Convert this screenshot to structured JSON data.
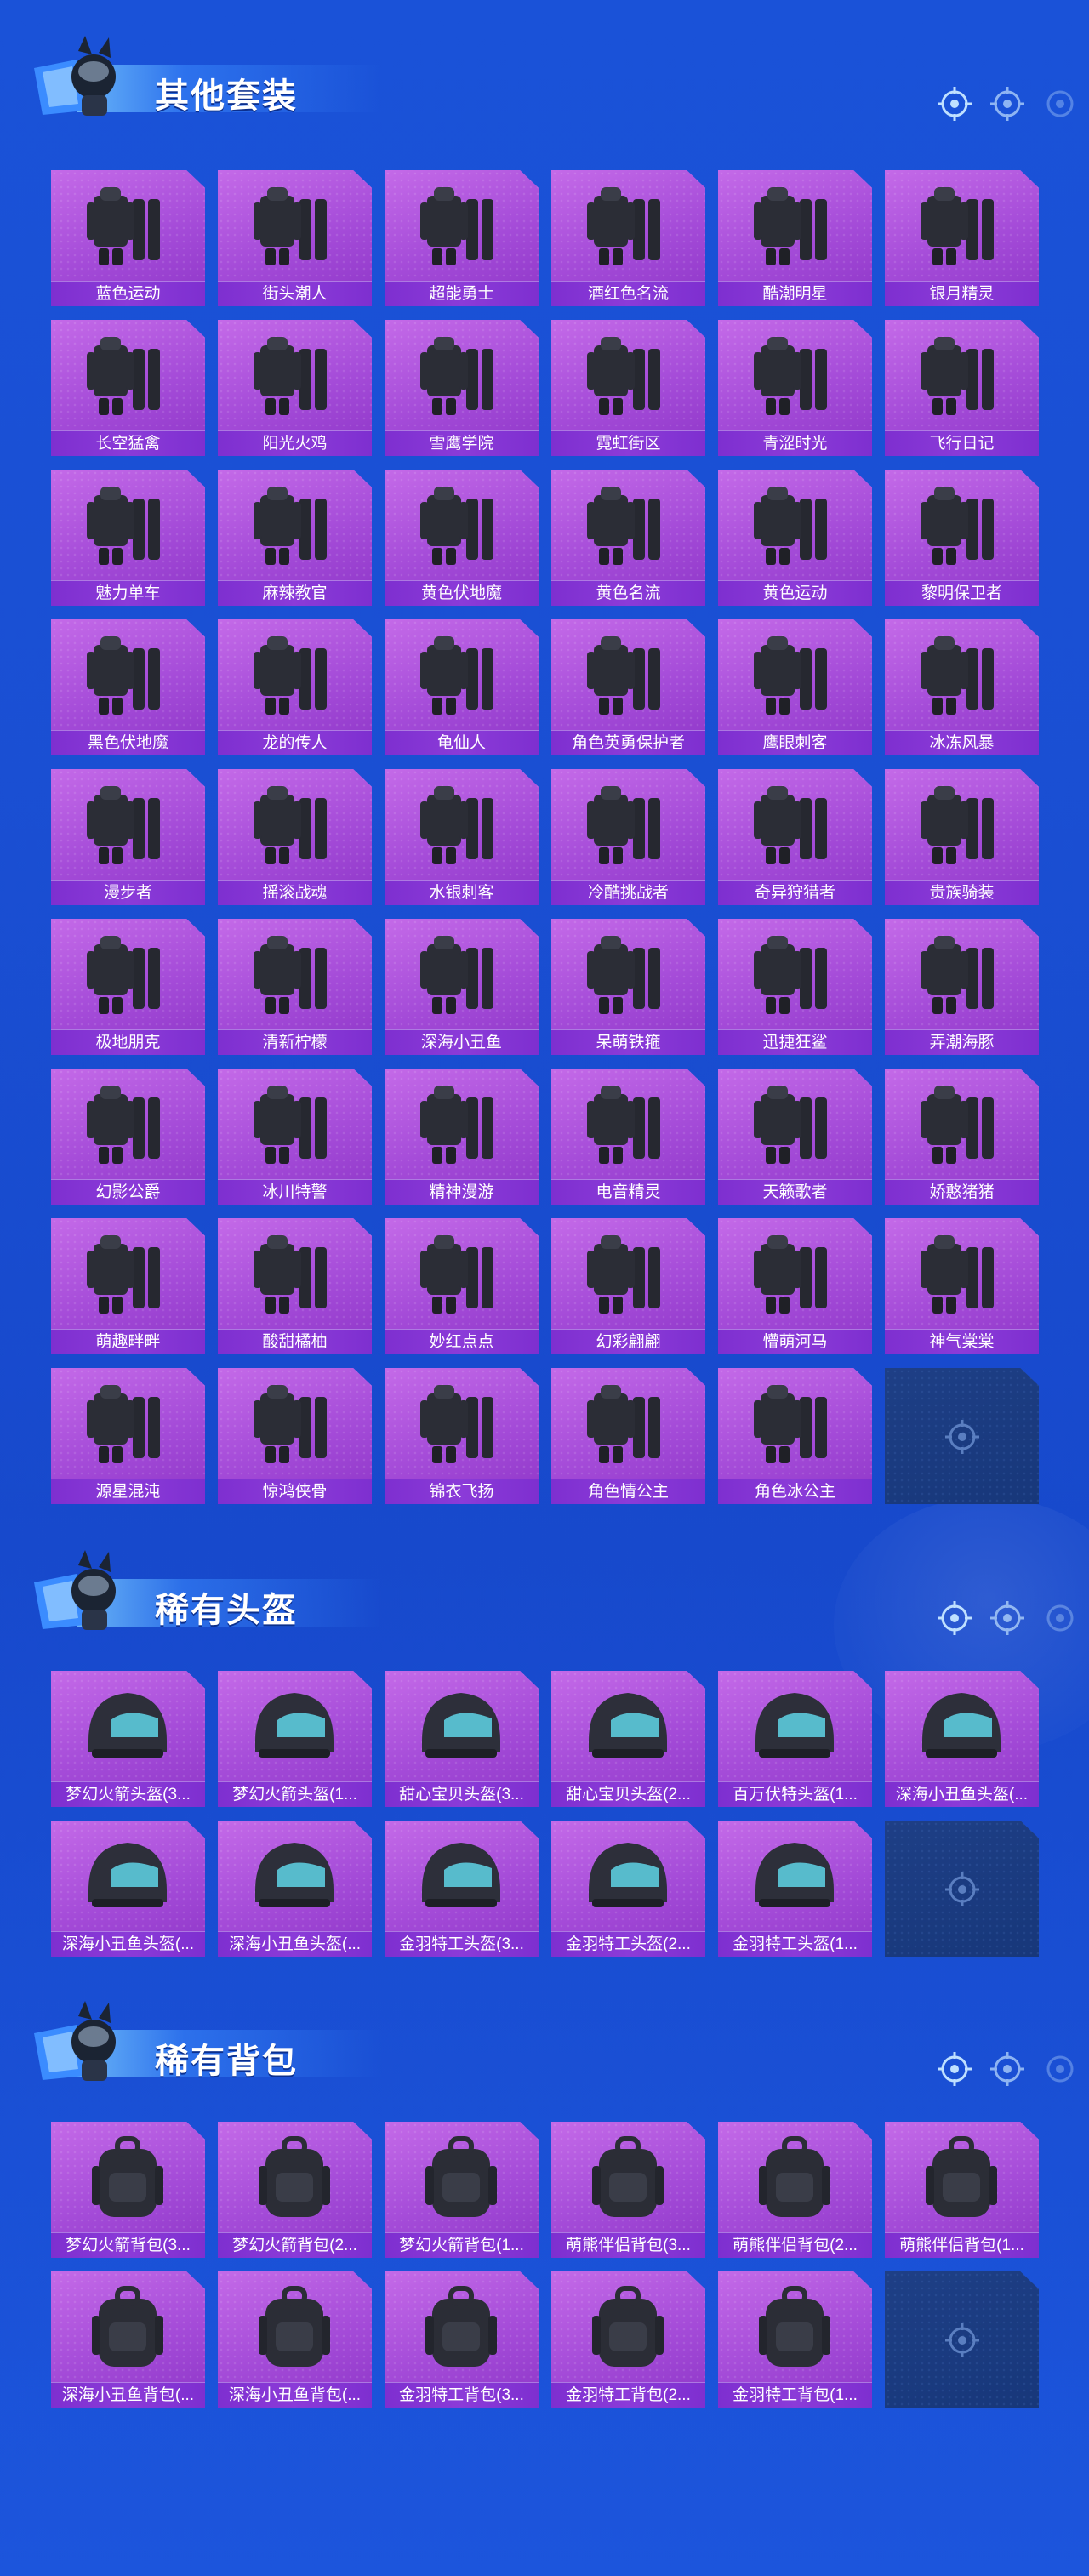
{
  "colors": {
    "background": "#1a52d8",
    "card": "#a44bd8",
    "label_bar": "#7e2fd0",
    "empty_card": "#1e3f86"
  },
  "sections": [
    {
      "title": "其他套装",
      "items": [
        {
          "label": "蓝色运动",
          "icon": "outfit-icon"
        },
        {
          "label": "街头潮人",
          "icon": "outfit-icon"
        },
        {
          "label": "超能勇士",
          "icon": "outfit-icon"
        },
        {
          "label": "酒红色名流",
          "icon": "outfit-icon"
        },
        {
          "label": "酷潮明星",
          "icon": "outfit-icon"
        },
        {
          "label": "银月精灵",
          "icon": "outfit-icon"
        },
        {
          "label": "长空猛禽",
          "icon": "outfit-icon"
        },
        {
          "label": "阳光火鸡",
          "icon": "outfit-icon"
        },
        {
          "label": "雪鹰学院",
          "icon": "outfit-icon"
        },
        {
          "label": "霓虹街区",
          "icon": "outfit-icon"
        },
        {
          "label": "青涩时光",
          "icon": "outfit-icon"
        },
        {
          "label": "飞行日记",
          "icon": "outfit-icon"
        },
        {
          "label": "魅力单车",
          "icon": "outfit-icon"
        },
        {
          "label": "麻辣教官",
          "icon": "outfit-icon"
        },
        {
          "label": "黄色伏地魔",
          "icon": "outfit-icon"
        },
        {
          "label": "黄色名流",
          "icon": "outfit-icon"
        },
        {
          "label": "黄色运动",
          "icon": "outfit-icon"
        },
        {
          "label": "黎明保卫者",
          "icon": "outfit-icon"
        },
        {
          "label": "黑色伏地魔",
          "icon": "outfit-icon"
        },
        {
          "label": "龙的传人",
          "icon": "outfit-icon"
        },
        {
          "label": "龟仙人",
          "icon": "outfit-icon"
        },
        {
          "label": "角色英勇保护者",
          "icon": "outfit-icon"
        },
        {
          "label": "鹰眼刺客",
          "icon": "outfit-icon"
        },
        {
          "label": "冰冻风暴",
          "icon": "outfit-icon"
        },
        {
          "label": "漫步者",
          "icon": "outfit-icon"
        },
        {
          "label": "摇滚战魂",
          "icon": "outfit-icon"
        },
        {
          "label": "水银刺客",
          "icon": "outfit-icon"
        },
        {
          "label": "冷酷挑战者",
          "icon": "outfit-icon"
        },
        {
          "label": "奇异狩猎者",
          "icon": "outfit-icon"
        },
        {
          "label": "贵族骑装",
          "icon": "outfit-icon"
        },
        {
          "label": "极地朋克",
          "icon": "outfit-icon"
        },
        {
          "label": "清新柠檬",
          "icon": "outfit-icon"
        },
        {
          "label": "深海小丑鱼",
          "icon": "outfit-icon"
        },
        {
          "label": "呆萌铁箍",
          "icon": "outfit-icon"
        },
        {
          "label": "迅捷狂鲨",
          "icon": "outfit-icon"
        },
        {
          "label": "弄潮海豚",
          "icon": "outfit-icon"
        },
        {
          "label": "幻影公爵",
          "icon": "outfit-icon"
        },
        {
          "label": "冰川特警",
          "icon": "outfit-icon"
        },
        {
          "label": "精神漫游",
          "icon": "outfit-icon"
        },
        {
          "label": "电音精灵",
          "icon": "outfit-icon"
        },
        {
          "label": "天籁歌者",
          "icon": "outfit-icon"
        },
        {
          "label": "娇憨猪猪",
          "icon": "outfit-icon"
        },
        {
          "label": "萌趣畔畔",
          "icon": "outfit-icon"
        },
        {
          "label": "酸甜橘柚",
          "icon": "outfit-icon"
        },
        {
          "label": "妙红点点",
          "icon": "outfit-icon"
        },
        {
          "label": "幻彩翩翩",
          "icon": "outfit-icon"
        },
        {
          "label": "懵萌河马",
          "icon": "outfit-icon"
        },
        {
          "label": "神气棠棠",
          "icon": "outfit-icon"
        },
        {
          "label": "源星混沌",
          "icon": "outfit-icon"
        },
        {
          "label": "惊鸿侠骨",
          "icon": "outfit-icon"
        },
        {
          "label": "锦衣飞扬",
          "icon": "outfit-icon"
        },
        {
          "label": "角色情公主",
          "icon": "outfit-icon"
        },
        {
          "label": "角色冰公主",
          "icon": "outfit-icon"
        },
        {
          "label": "",
          "icon": "empty"
        }
      ]
    },
    {
      "title": "稀有头盔",
      "items": [
        {
          "label": "梦幻火箭头盔(3...",
          "icon": "helmet-icon"
        },
        {
          "label": "梦幻火箭头盔(1...",
          "icon": "helmet-icon"
        },
        {
          "label": "甜心宝贝头盔(3...",
          "icon": "helmet-icon"
        },
        {
          "label": "甜心宝贝头盔(2...",
          "icon": "helmet-icon"
        },
        {
          "label": "百万伏特头盔(1...",
          "icon": "helmet-icon"
        },
        {
          "label": "深海小丑鱼头盔(...",
          "icon": "helmet-icon"
        },
        {
          "label": "深海小丑鱼头盔(...",
          "icon": "helmet-icon"
        },
        {
          "label": "深海小丑鱼头盔(...",
          "icon": "helmet-icon"
        },
        {
          "label": "金羽特工头盔(3...",
          "icon": "helmet-icon"
        },
        {
          "label": "金羽特工头盔(2...",
          "icon": "helmet-icon"
        },
        {
          "label": "金羽特工头盔(1...",
          "icon": "helmet-icon"
        },
        {
          "label": "",
          "icon": "empty"
        }
      ]
    },
    {
      "title": "稀有背包",
      "items": [
        {
          "label": "梦幻火箭背包(3...",
          "icon": "backpack-icon"
        },
        {
          "label": "梦幻火箭背包(2...",
          "icon": "backpack-icon"
        },
        {
          "label": "梦幻火箭背包(1...",
          "icon": "backpack-icon"
        },
        {
          "label": "萌熊伴侣背包(3...",
          "icon": "backpack-icon"
        },
        {
          "label": "萌熊伴侣背包(2...",
          "icon": "backpack-icon"
        },
        {
          "label": "萌熊伴侣背包(1...",
          "icon": "backpack-icon"
        },
        {
          "label": "深海小丑鱼背包(...",
          "icon": "backpack-icon"
        },
        {
          "label": "深海小丑鱼背包(...",
          "icon": "backpack-icon"
        },
        {
          "label": "金羽特工背包(3...",
          "icon": "backpack-icon"
        },
        {
          "label": "金羽特工背包(2...",
          "icon": "backpack-icon"
        },
        {
          "label": "金羽特工背包(1...",
          "icon": "backpack-icon"
        },
        {
          "label": "",
          "icon": "empty"
        }
      ]
    }
  ]
}
